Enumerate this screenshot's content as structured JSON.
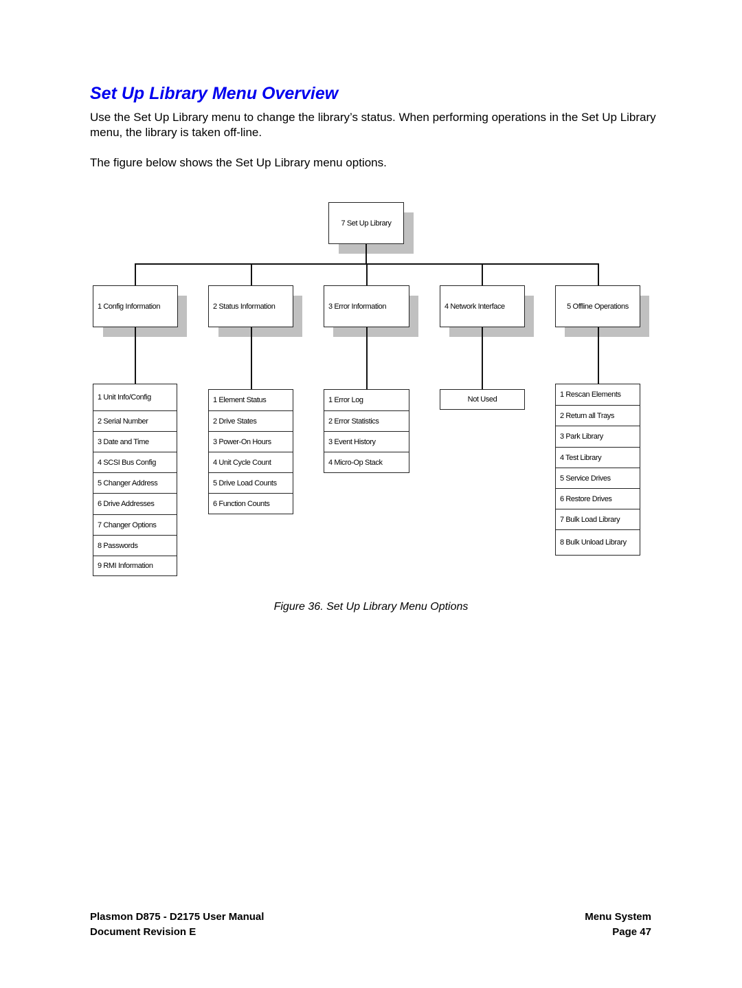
{
  "page": {
    "title": "Set Up Library Menu Overview",
    "paragraphs": [
      "Use the Set Up Library menu to change the library’s status. When performing operations in the Set Up Library menu, the library is taken off-line.",
      "The figure below shows the Set Up Library menu options."
    ]
  },
  "diagram": {
    "root": "7 Set Up Library",
    "branches": [
      {
        "label": "1 Config  Information",
        "items": [
          "1 Unit Info/Config",
          "2 Serial Number",
          "3 Date and Time",
          "4 SCSI Bus Config",
          "5 Changer Address",
          "6 Drive Addresses",
          "7 Changer Options",
          "8  Passwords",
          "9 RMI Information"
        ]
      },
      {
        "label": "2 Status  Information",
        "items": [
          "1 Element Status",
          "2 Drive States",
          "3 Power-On Hours",
          "4 Unit Cycle Count",
          "5 Drive Load Counts",
          "6 Function Counts"
        ]
      },
      {
        "label": "3 Error Information",
        "items": [
          "1 Error Log",
          "2 Error Statistics",
          "3 Event History",
          "4 Micro-Op Stack"
        ]
      },
      {
        "label": "4 Network Interface",
        "items": [
          "Not Used"
        ]
      },
      {
        "label": "5 Offline Operations",
        "items": [
          "1 Rescan Elements",
          "2 Return all Trays",
          "3 Park Library",
          "4 Test Library",
          "5 Service Drives",
          "6 Restore Drives",
          "7 Bulk Load Library",
          "8 Bulk Unload Library"
        ]
      }
    ]
  },
  "caption": "Figure 36. Set Up Library Menu Options",
  "footer": {
    "left_line1": "Plasmon D875 - D2175 User Manual",
    "left_line2": "Document Revision E",
    "right_line1": "Menu System",
    "right_line2": "Page 47"
  }
}
